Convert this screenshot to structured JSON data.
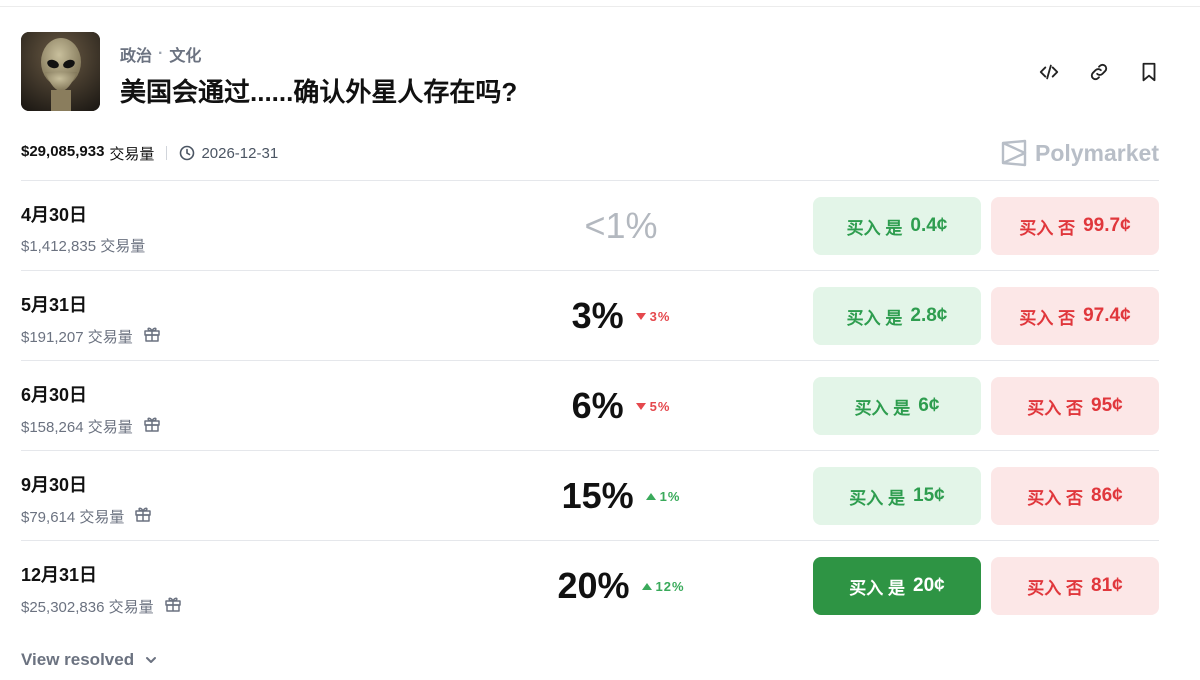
{
  "header": {
    "tags": [
      "政治",
      "文化"
    ],
    "tag_separator": "·",
    "title": "美国会通过......确认外星人存在吗?",
    "thumbnail_icon": "alien-image"
  },
  "actions": {
    "embed_icon": "code-icon",
    "link_icon": "link-icon",
    "bookmark_icon": "bookmark-icon"
  },
  "meta": {
    "volume": "$29,085,933",
    "volume_unit": "交易量",
    "end_date": "2026-12-31",
    "brand": "Polymarket"
  },
  "markets": [
    {
      "label": "4月30日",
      "volume": "$1,412,835 交易量",
      "has_reward": false,
      "pct": "<1%",
      "muted": true,
      "change": null,
      "change_dir": null,
      "yes": {
        "label": "买入 是",
        "price": "0.4¢",
        "active": false
      },
      "no": {
        "label": "买入 否",
        "price": "99.7¢"
      }
    },
    {
      "label": "5月31日",
      "volume": "$191,207 交易量",
      "has_reward": true,
      "pct": "3%",
      "muted": false,
      "change": "3%",
      "change_dir": "down",
      "yes": {
        "label": "买入 是",
        "price": "2.8¢",
        "active": false
      },
      "no": {
        "label": "买入 否",
        "price": "97.4¢"
      }
    },
    {
      "label": "6月30日",
      "volume": "$158,264 交易量",
      "has_reward": true,
      "pct": "6%",
      "muted": false,
      "change": "5%",
      "change_dir": "down",
      "yes": {
        "label": "买入 是",
        "price": "6¢",
        "active": false
      },
      "no": {
        "label": "买入 否",
        "price": "95¢"
      }
    },
    {
      "label": "9月30日",
      "volume": "$79,614 交易量",
      "has_reward": true,
      "pct": "15%",
      "muted": false,
      "change": "1%",
      "change_dir": "up",
      "yes": {
        "label": "买入 是",
        "price": "15¢",
        "active": false
      },
      "no": {
        "label": "买入 否",
        "price": "86¢"
      }
    },
    {
      "label": "12月31日",
      "volume": "$25,302,836 交易量",
      "has_reward": true,
      "pct": "20%",
      "muted": false,
      "change": "12%",
      "change_dir": "up",
      "yes": {
        "label": "买入 是",
        "price": "20¢",
        "active": true
      },
      "no": {
        "label": "买入 否",
        "price": "81¢"
      }
    }
  ],
  "footer": {
    "view_resolved": "View resolved"
  },
  "colors": {
    "yes_text": "#2e9d4f",
    "yes_bg": "#e3f5e8",
    "yes_active_bg": "#2e9444",
    "no_text": "#e0373c",
    "no_bg": "#fce7e7"
  }
}
